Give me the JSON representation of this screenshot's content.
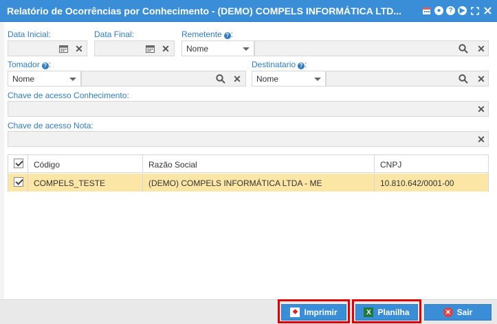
{
  "window": {
    "title": "Relatório de Ocorrências por Conhecimento - (DEMO) COMPELS INFORMÁTICA LTD..."
  },
  "title_icons": [
    "calendar-icon",
    "record-icon",
    "help-icon",
    "play-icon",
    "fullscreen-icon",
    "close-icon"
  ],
  "filters": {
    "data_inicial_label": "Data Inicial:",
    "data_final_label": "Data Final:",
    "remetente_label": "Remetente",
    "remetente_select": "Nome",
    "tomador_label": "Tomador",
    "tomador_select": "Nome",
    "destinatario_label": "Destinatario",
    "destinatario_select": "Nome",
    "chave_conhecimento_label": "Chave de acesso Conhecimento:",
    "chave_nota_label": "Chave de acesso Nota:"
  },
  "grid": {
    "columns": [
      "Código",
      "Razão Social",
      "CNPJ"
    ],
    "rows": [
      {
        "codigo": "COMPELS_TESTE",
        "razao_social": "(DEMO) COMPELS INFORMÁTICA LTDA - ME",
        "cnpj": "10.810.642/0001-00",
        "checked": true
      }
    ]
  },
  "buttons": {
    "imprimir": "Imprimir",
    "planilha": "Planilha",
    "sair": "Sair"
  },
  "colors": {
    "titlebar": "#3a8ed8",
    "label": "#2f7cc4",
    "selected_row": "#fbe6a6",
    "highlight_outline": "#e00000"
  }
}
